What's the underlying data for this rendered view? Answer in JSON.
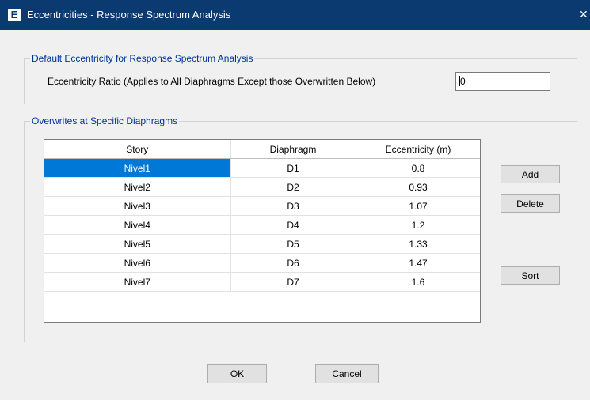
{
  "window": {
    "title": "Eccentricities - Response Spectrum Analysis",
    "app_icon_letter": "E",
    "close_glyph": "✕"
  },
  "default_group": {
    "legend": "Default Eccentricity for Response Spectrum Analysis",
    "ratio_label": "Eccentricity Ratio (Applies to All Diaphragms Except those Overwritten Below)",
    "ratio_value": "0"
  },
  "overwrites_group": {
    "legend": "Overwrites at Specific Diaphragms",
    "columns": [
      "Story",
      "Diaphragm",
      "Eccentricity (m)"
    ],
    "rows": [
      {
        "story": "Nivel1",
        "diaphragm": "D1",
        "eccentricity": "0.8"
      },
      {
        "story": "Nivel2",
        "diaphragm": "D2",
        "eccentricity": "0.93"
      },
      {
        "story": "Nivel3",
        "diaphragm": "D3",
        "eccentricity": "1.07"
      },
      {
        "story": "Nivel4",
        "diaphragm": "D4",
        "eccentricity": "1.2"
      },
      {
        "story": "Nivel5",
        "diaphragm": "D5",
        "eccentricity": "1.33"
      },
      {
        "story": "Nivel6",
        "diaphragm": "D6",
        "eccentricity": "1.47"
      },
      {
        "story": "Nivel7",
        "diaphragm": "D7",
        "eccentricity": "1.6"
      }
    ],
    "selected_row": 0,
    "selection_color": "#0078d7",
    "add_label": "Add",
    "delete_label": "Delete",
    "sort_label": "Sort"
  },
  "footer": {
    "ok_label": "OK",
    "cancel_label": "Cancel"
  },
  "colors": {
    "titlebar": "#0b3a71",
    "legend_text": "#003399"
  }
}
